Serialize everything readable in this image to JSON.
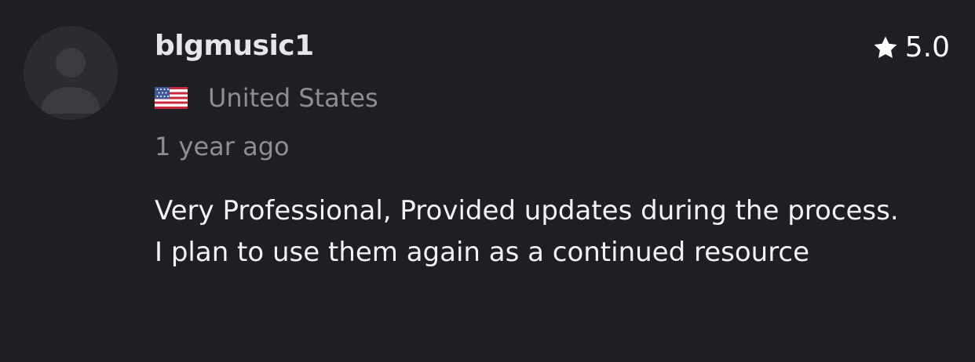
{
  "review": {
    "username": "blgmusic1",
    "rating": "5.0",
    "country": "United States",
    "time_ago": "1 year ago",
    "text": "Very Professional, Provided updates during the process. I plan to use them again as a continued resource"
  },
  "icons": {
    "avatar": "default-user-avatar-icon",
    "flag": "us-flag-icon",
    "star": "star-icon"
  },
  "colors": {
    "background": "#1e1f22",
    "avatar_background": "#2b2c30",
    "muted_text": "#8d8e93",
    "primary_text": "#f2f2f4"
  }
}
